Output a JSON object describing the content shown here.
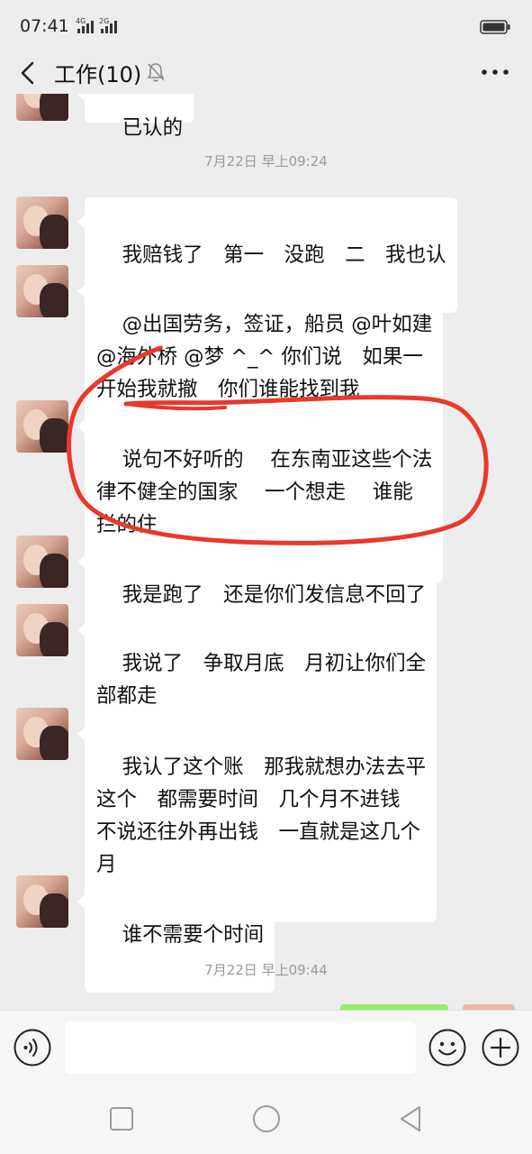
{
  "status_bar": {
    "time": "07:41",
    "network_1": "4G",
    "network_2": "2G"
  },
  "header": {
    "title": "工作(10)"
  },
  "chat": {
    "partial_top_text": "已认的",
    "separator_1": "7月22日 早上09:24",
    "separator_2": "7月22日 早上09:44",
    "messages": [
      {
        "text": "我赔钱了　第一　没跑　二　我也认"
      },
      {
        "text": "@出国劳务，签证，船员 @叶如建\n@海外桥 @梦 ^_^ 你们说　如果一\n开始我就撤　你们谁能找到我"
      },
      {
        "text": "说句不好听的　 在东南亚这些个法\n律不健全的国家　 一个想走　 谁能\n拦的住"
      },
      {
        "text": "我是跑了　还是你们发信息不回了"
      },
      {
        "text": "我说了　争取月底　月初让你们全\n部都走"
      },
      {
        "text": "我认了这个账　那我就想办法去平\n这个　都需要时间　几个月不进钱\n不说还往外再出钱　一直就是这几个\n月"
      },
      {
        "text": "谁不需要个时间"
      }
    ]
  },
  "annotation": {
    "color": "#e8392b"
  },
  "input_bar": {
    "value": ""
  },
  "icons": {
    "back": "chevron-left-icon",
    "mute": "bell-off-icon",
    "more": "more-dots-icon",
    "voice": "voice-icon",
    "emoji": "emoji-icon",
    "plus": "plus-icon"
  }
}
